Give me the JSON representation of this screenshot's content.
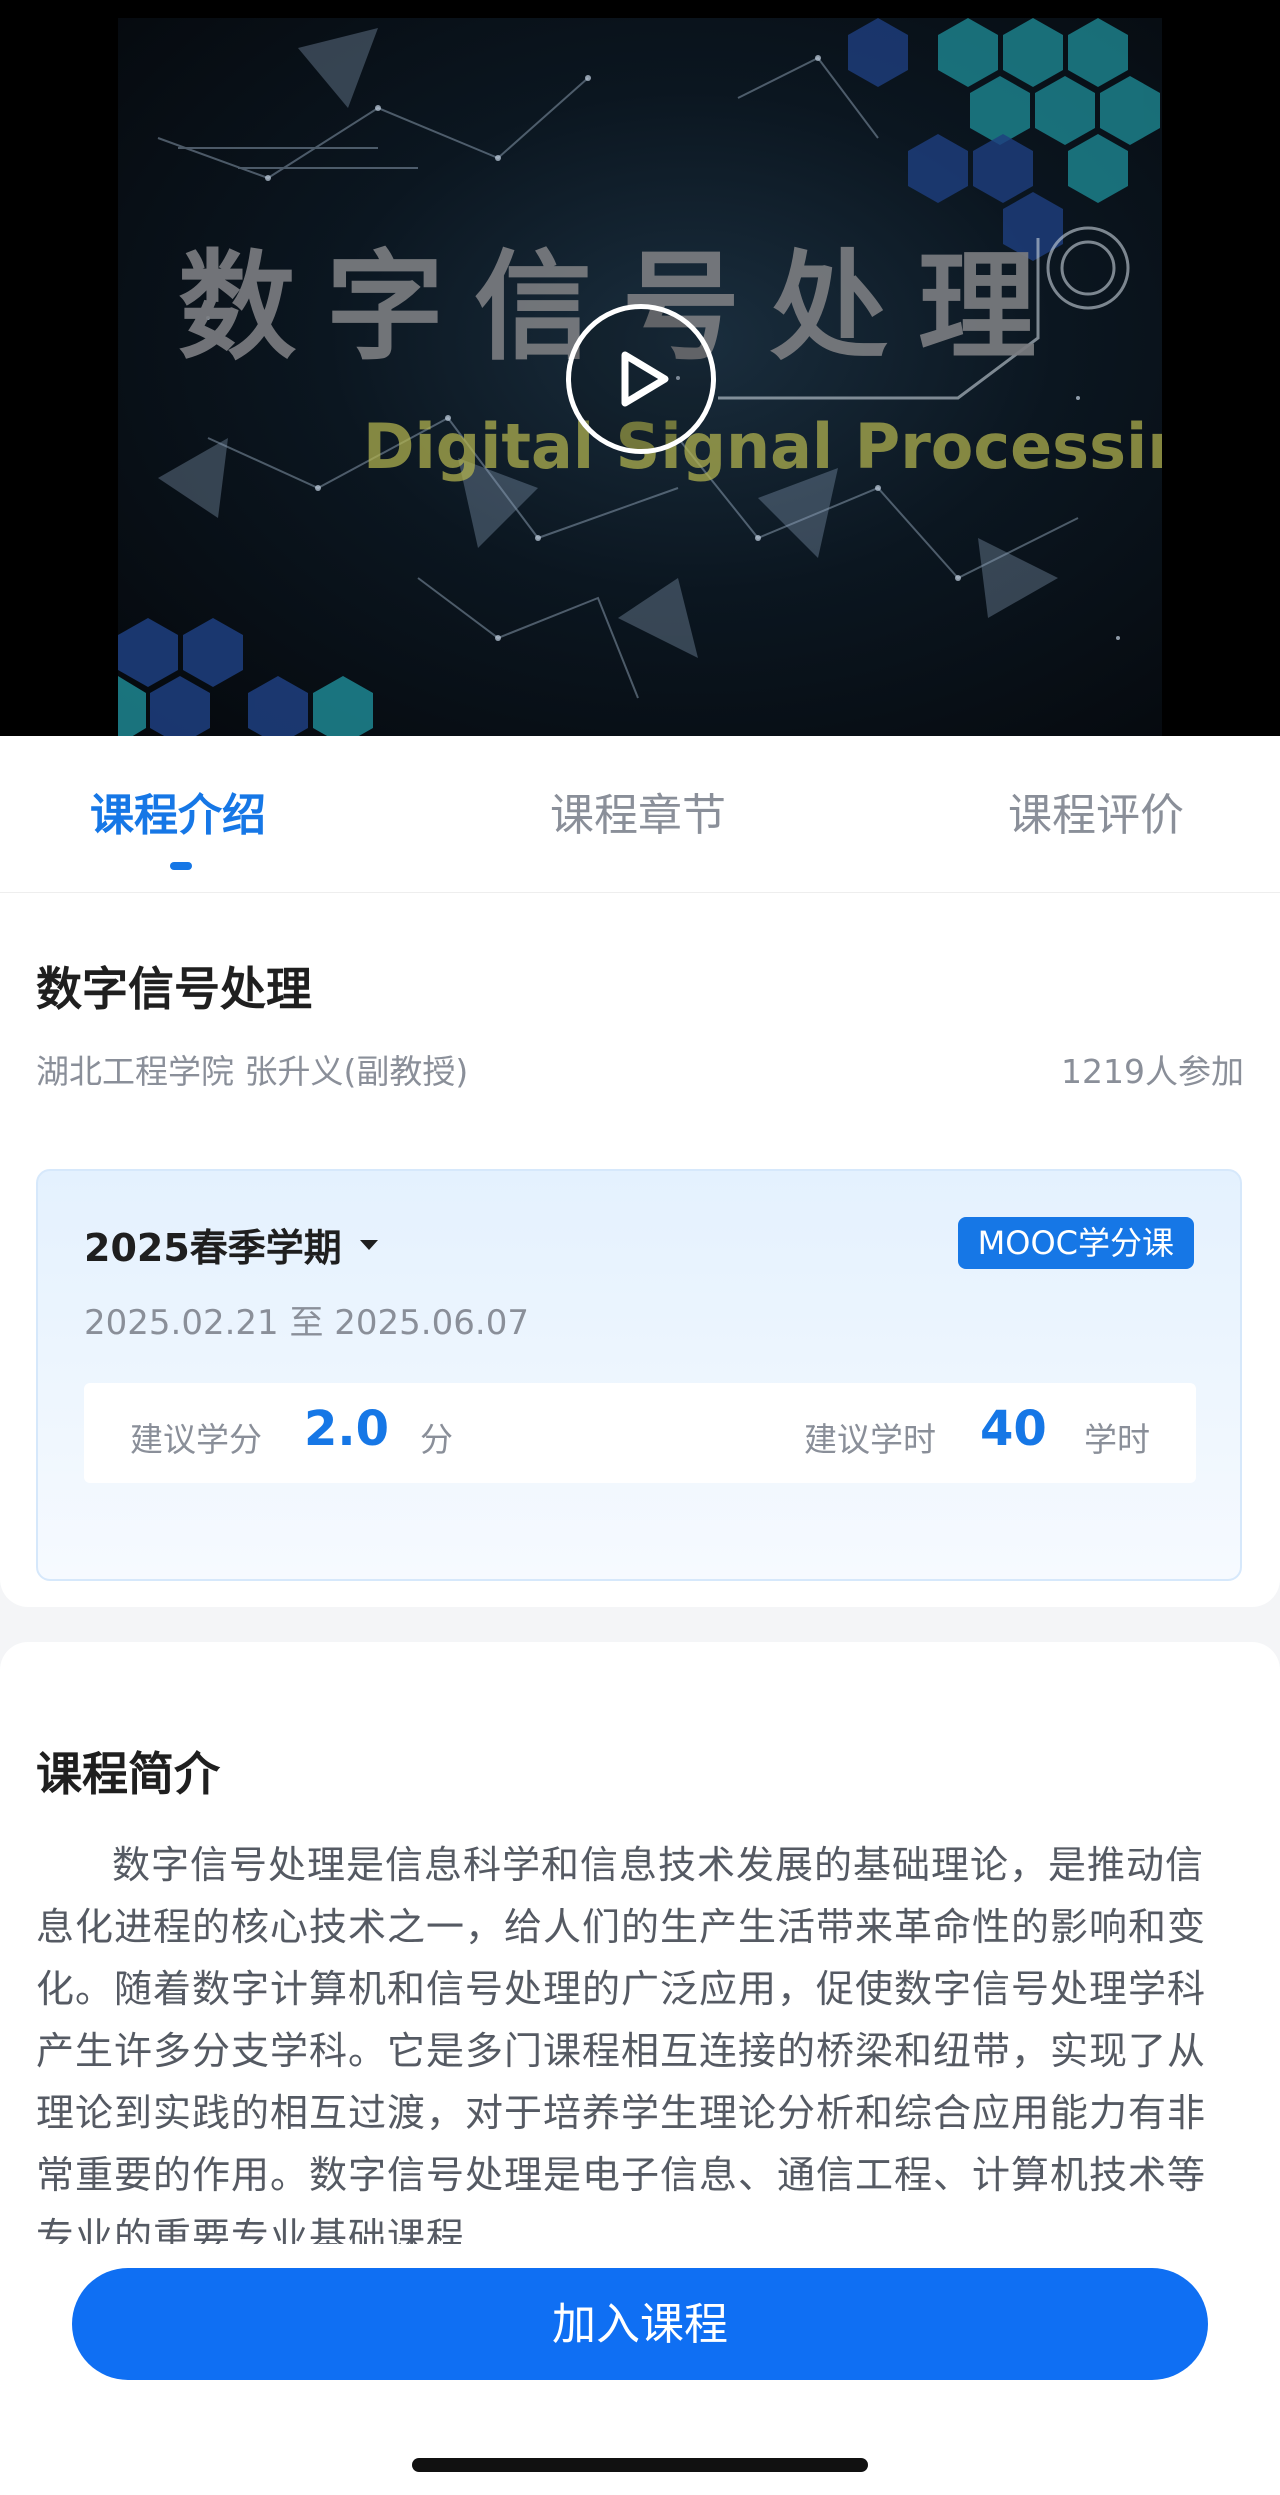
{
  "video": {
    "title_zh": "数字信号处理",
    "title_en": "Digital Signal Processing",
    "play_icon": "play-icon"
  },
  "tabs": [
    {
      "label": "课程介绍",
      "active": true
    },
    {
      "label": "课程章节",
      "active": false
    },
    {
      "label": "课程评价",
      "active": false
    }
  ],
  "course": {
    "title": "数字信号处理",
    "school_teacher": "湖北工程学院 张升义(副教授)",
    "participants": "1219人参加"
  },
  "semester": {
    "name": "2025春季学期",
    "badge": "MOOC学分课",
    "date_range": "2025.02.21 至 2025.06.07",
    "credit_label": "建议学分",
    "credit_value": "2.0",
    "credit_unit": "分",
    "hours_label": "建议学时",
    "hours_value": "40",
    "hours_unit": "学时"
  },
  "intro": {
    "heading": "课程简介",
    "text": "数字信号处理是信息科学和信息技术发展的基础理论，是推动信息化进程的核心技术之一，给人们的生产生活带来革命性的影响和变化。随着数字计算机和信号处理的广泛应用，促使数字信号处理学科产生许多分支学科。它是多门课程相互连接的桥梁和纽带，实现了从理论到实践的相互过渡，对于培养学生理论分析和综合应用能力有非常重要的作用。数字信号处理是电子信息、通信工程、计算机技术等专业的重要专业基础课程"
  },
  "actions": {
    "join_label": "加入课程"
  },
  "colors": {
    "accent": "#1677e6",
    "button": "#0f6ff3",
    "text_primary": "#1f1f1f",
    "text_secondary": "#8a8f99"
  }
}
